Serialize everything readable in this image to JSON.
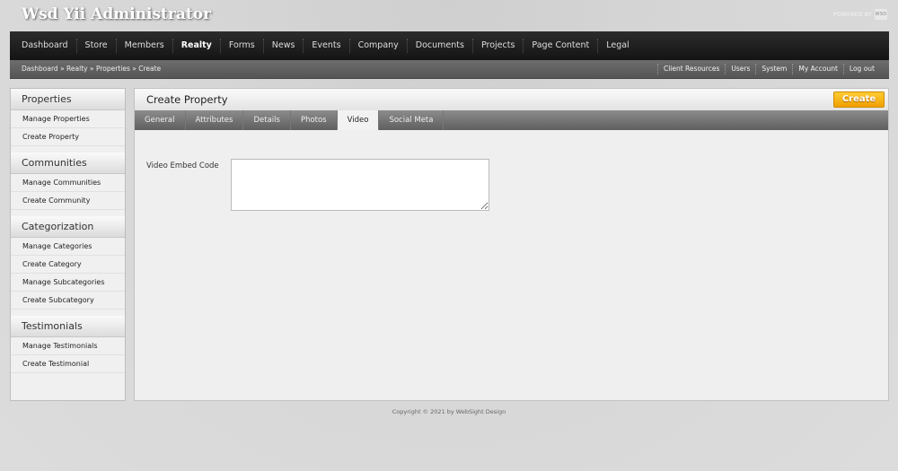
{
  "app": {
    "title": "Wsd Yii Administrator",
    "powered_by": "POWERED BY",
    "powered_logo": "WSD"
  },
  "mainnav": {
    "items": [
      "Dashboard",
      "Store",
      "Members",
      "Realty",
      "Forms",
      "News",
      "Events",
      "Company",
      "Documents",
      "Projects",
      "Page Content",
      "Legal"
    ],
    "active": "Realty"
  },
  "breadcrumb": "Dashboard » Realty » Properties » Create",
  "utility_links": [
    "Client Resources",
    "Users",
    "System",
    "My Account",
    "Log out"
  ],
  "sidebar": {
    "sections": [
      {
        "title": "Properties",
        "items": [
          "Manage Properties",
          "Create Property"
        ]
      },
      {
        "title": "Communities",
        "items": [
          "Manage Communities",
          "Create Community"
        ]
      },
      {
        "title": "Categorization",
        "items": [
          "Manage Categories",
          "Create Category",
          "Manage Subcategories",
          "Create Subcategory"
        ]
      },
      {
        "title": "Testimonials",
        "items": [
          "Manage Testimonials",
          "Create Testimonial"
        ]
      }
    ]
  },
  "panel": {
    "title": "Create Property",
    "create_button": "Create",
    "tabs": [
      "General",
      "Attributes",
      "Details",
      "Photos",
      "Video",
      "Social Meta"
    ],
    "active_tab": "Video",
    "field_label": "Video Embed Code",
    "field_value": ""
  },
  "footer": "Copyright © 2021 by WebSight Design",
  "colors": {
    "accent": "#f0a000",
    "nav_bg": "#1e1e1e"
  }
}
